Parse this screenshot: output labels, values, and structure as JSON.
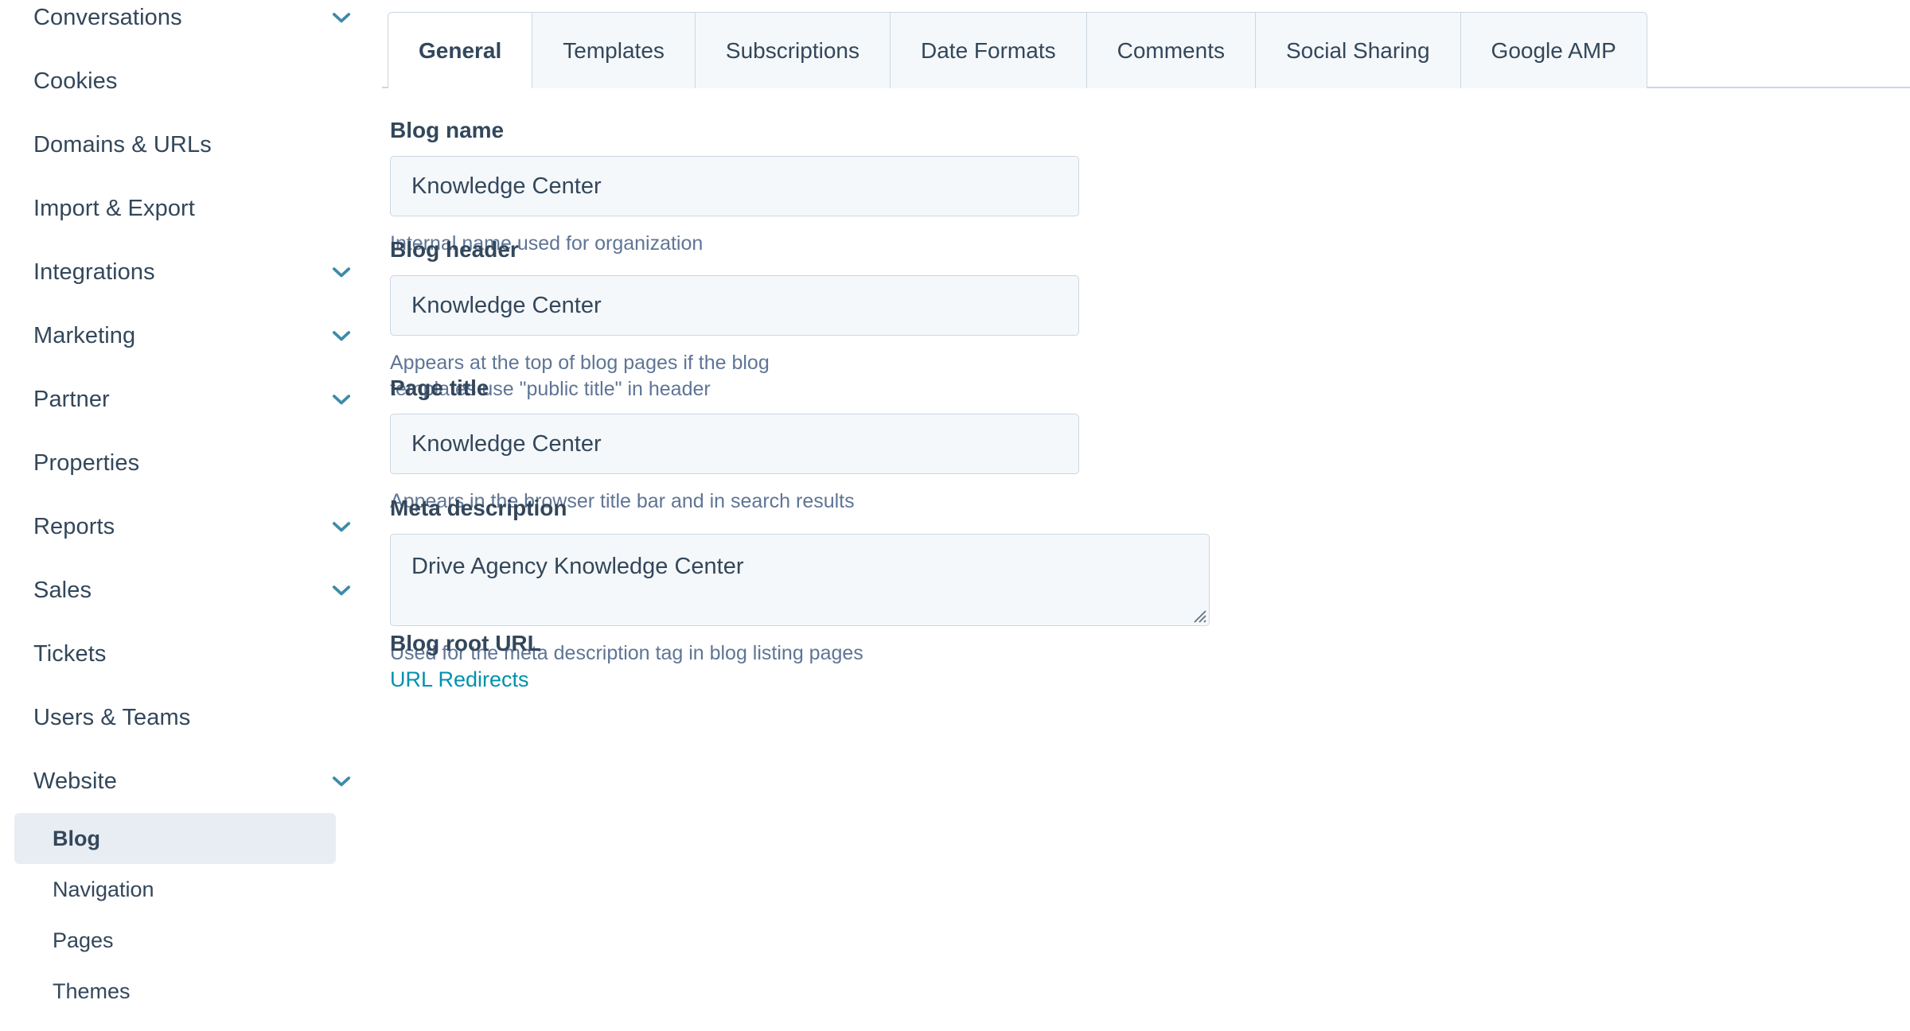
{
  "sidebar": {
    "items": [
      {
        "label": "Conversations",
        "expandable": true,
        "partial": true
      },
      {
        "label": "Cookies",
        "expandable": false,
        "partial": false
      },
      {
        "label": "Domains & URLs",
        "expandable": false,
        "partial": false
      },
      {
        "label": "Import & Export",
        "expandable": false,
        "partial": false
      },
      {
        "label": "Integrations",
        "expandable": true,
        "partial": false
      },
      {
        "label": "Marketing",
        "expandable": true,
        "partial": false
      },
      {
        "label": "Partner",
        "expandable": true,
        "partial": false
      },
      {
        "label": "Properties",
        "expandable": false,
        "partial": false
      },
      {
        "label": "Reports",
        "expandable": true,
        "partial": false
      },
      {
        "label": "Sales",
        "expandable": true,
        "partial": false
      },
      {
        "label": "Tickets",
        "expandable": false,
        "partial": false
      },
      {
        "label": "Users & Teams",
        "expandable": false,
        "partial": false
      },
      {
        "label": "Website",
        "expandable": true,
        "partial": false
      }
    ],
    "subitems": [
      {
        "label": "Blog",
        "active": true
      },
      {
        "label": "Navigation",
        "active": false
      },
      {
        "label": "Pages",
        "active": false
      },
      {
        "label": "Themes",
        "active": false
      }
    ]
  },
  "tabs": [
    {
      "label": "General",
      "active": true
    },
    {
      "label": "Templates",
      "active": false
    },
    {
      "label": "Subscriptions",
      "active": false
    },
    {
      "label": "Date Formats",
      "active": false
    },
    {
      "label": "Comments",
      "active": false
    },
    {
      "label": "Social Sharing",
      "active": false
    },
    {
      "label": "Google AMP",
      "active": false
    }
  ],
  "form": {
    "blog_name": {
      "label": "Blog name",
      "value": "Knowledge Center",
      "help": "Internal name used for organization"
    },
    "blog_header": {
      "label": "Blog header",
      "value": "Knowledge Center",
      "help": "Appears at the top of blog pages if the blog templates use \"public title\" in header"
    },
    "page_title": {
      "label": "Page title",
      "value": "Knowledge Center",
      "help": "Appears in the browser title bar and in search results"
    },
    "meta_description": {
      "label": "Meta description",
      "value": "Drive Agency Knowledge Center",
      "help": "Used for the meta description tag in blog listing pages"
    },
    "blog_root_url": {
      "label": "Blog root URL",
      "link_label": "URL Redirects"
    }
  },
  "colors": {
    "text": "#33475b",
    "help_text": "#5f7596",
    "link": "#0091ae",
    "chevron": "#3d8ba8",
    "border": "#cbd6e2",
    "field_bg": "#f5f8fa",
    "active_nav_bg": "#e8edf3"
  }
}
